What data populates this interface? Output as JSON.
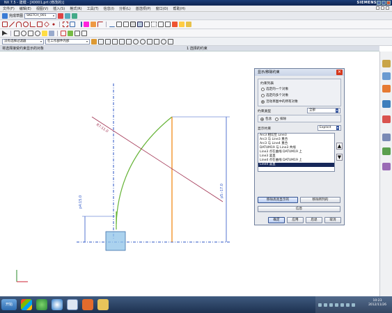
{
  "window": {
    "title": "NX 7.5 - 建模 - [X0001.prt (修改的)]",
    "brand": "SIEMENS"
  },
  "menu": [
    "文件(F)",
    "编辑(E)",
    "视图(V)",
    "插入(S)",
    "格式(R)",
    "工具(T)",
    "信息(I)",
    "分析(L)",
    "首选项(P)",
    "窗口(O)",
    "帮助(H)"
  ],
  "toolbar": {
    "finish_sketch": "完成草图",
    "sketch_name": "SKETCH_001",
    "filter_select": "没有选择过滤器",
    "scope_select": "在工作部件内部"
  },
  "subtitle": {
    "left": "将选择接受约束显示的对象",
    "center": "1 选择的约束"
  },
  "canvas": {
    "dim_left": "p4:15.0",
    "dim_right": "p5:-17.0",
    "dim_radius": "R7:11.0"
  },
  "dialog": {
    "title": "显示/移除约束",
    "group_title": "约束列表",
    "radio": [
      "选定的一个对象",
      "选定的多个对象",
      "活动草图中的所有对象"
    ],
    "radio_selected": 2,
    "constraint_type_label": "约束类型",
    "constraint_type_value": "全部",
    "include": "包含",
    "exclude": "排除",
    "shown_label": "显示约束",
    "shown_value": "Explicit",
    "list": [
      "Arc3 相切至 Line3",
      "Arc3 与 Line3 重合",
      "Arc3 与 Line4 重合",
      "DATUM19 与 Line3 共线",
      "Line3 点在曲线 DATUM19 上",
      "Line3 竖直",
      "Line4 点在曲线 DATUM19 上",
      "Line4 竖直"
    ],
    "selected_index": 7,
    "btn_remove_selected": "移除高亮显示的",
    "btn_remove_listed": "移除所列的",
    "btn_info": "信息",
    "btn_ok": "确定",
    "btn_apply": "应用",
    "btn_back": "后退",
    "btn_cancel": "取消"
  },
  "taskbar": {
    "start": "开始",
    "time": "10:23",
    "date": "2012/11/26"
  },
  "colors": {
    "titlebar": "#1c3d78",
    "arc": "#64b334",
    "dim": "#2a53c6",
    "orange": "#f08a18",
    "constraint_line": "#a03050",
    "highlight_rect": "#8fc3e8"
  }
}
